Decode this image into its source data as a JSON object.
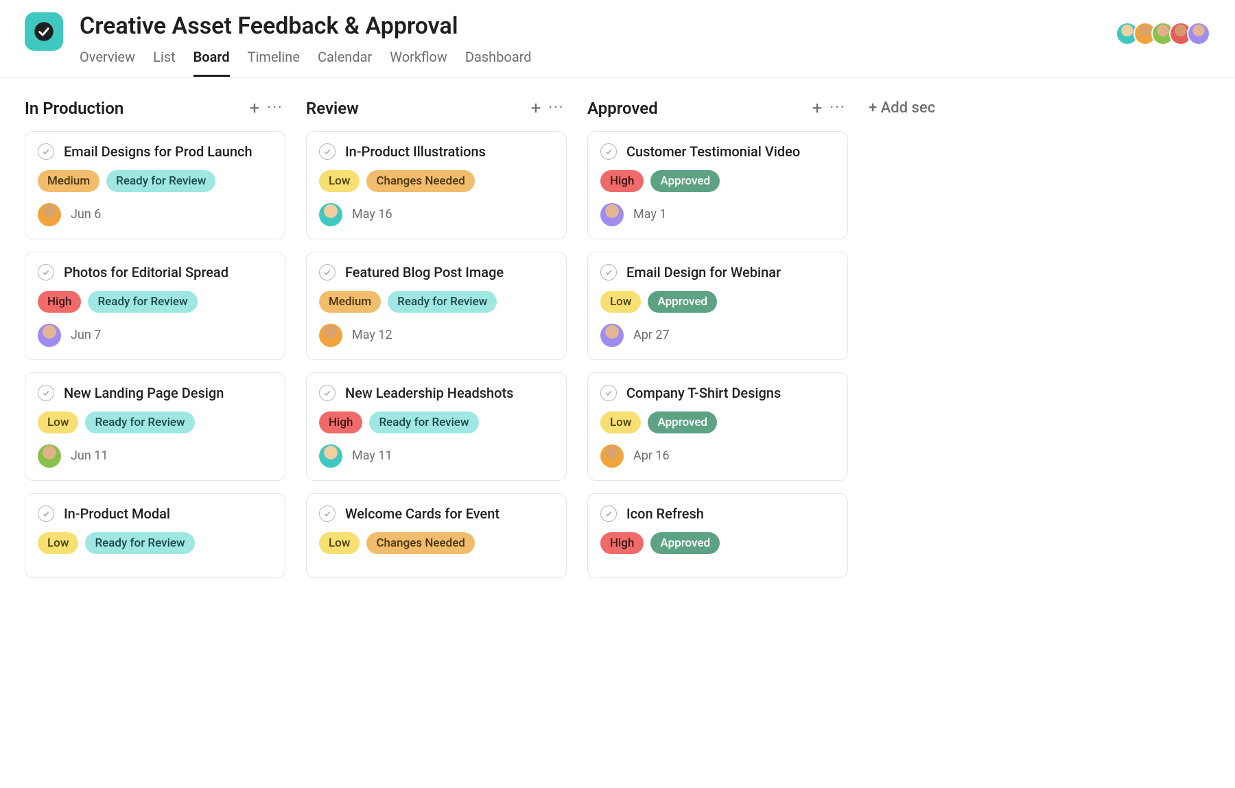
{
  "project": {
    "title": "Creative Asset Feedback & Approval",
    "tabs": [
      "Overview",
      "List",
      "Board",
      "Timeline",
      "Calendar",
      "Workflow",
      "Dashboard"
    ],
    "active_tab": "Board",
    "members": [
      "teal",
      "orange",
      "green",
      "red",
      "purple"
    ]
  },
  "add_section_label": "+ Add sec",
  "tag_colors": {
    "High": {
      "bg": "#f06a6a",
      "fg": "#3a1717"
    },
    "Medium": {
      "bg": "#f1bd6c",
      "fg": "#4a3510"
    },
    "Low": {
      "bg": "#f8df72",
      "fg": "#4a4010"
    },
    "Ready for Review": {
      "bg": "#9ee7e3",
      "fg": "#1d4946"
    },
    "Changes Needed": {
      "bg": "#f1bd6c",
      "fg": "#4a3510"
    },
    "Approved": {
      "bg": "#5da283",
      "fg": "#ffffff"
    }
  },
  "columns": [
    {
      "title": "In Production",
      "cards": [
        {
          "title": "Email Designs for Prod Launch",
          "tags": [
            "Medium",
            "Ready for Review"
          ],
          "assignee": "orange",
          "due": "Jun 6"
        },
        {
          "title": "Photos for Editorial Spread",
          "tags": [
            "High",
            "Ready for Review"
          ],
          "assignee": "purple",
          "due": "Jun 7"
        },
        {
          "title": "New Landing Page Design",
          "tags": [
            "Low",
            "Ready for Review"
          ],
          "assignee": "green",
          "due": "Jun 11"
        },
        {
          "title": "In-Product Modal",
          "tags": [
            "Low",
            "Ready for Review"
          ],
          "assignee": "",
          "due": ""
        }
      ]
    },
    {
      "title": "Review",
      "cards": [
        {
          "title": "In-Product Illustrations",
          "tags": [
            "Low",
            "Changes Needed"
          ],
          "assignee": "teal",
          "due": "May 16"
        },
        {
          "title": "Featured Blog Post Image",
          "tags": [
            "Medium",
            "Ready for Review"
          ],
          "assignee": "orange",
          "due": "May 12"
        },
        {
          "title": "New Leadership Headshots",
          "tags": [
            "High",
            "Ready for Review"
          ],
          "assignee": "teal",
          "due": "May 11"
        },
        {
          "title": "Welcome Cards for Event",
          "tags": [
            "Low",
            "Changes Needed"
          ],
          "assignee": "",
          "due": ""
        }
      ]
    },
    {
      "title": "Approved",
      "cards": [
        {
          "title": "Customer Testimonial Video",
          "tags": [
            "High",
            "Approved"
          ],
          "assignee": "purple",
          "due": "May 1"
        },
        {
          "title": "Email Design for Webinar",
          "tags": [
            "Low",
            "Approved"
          ],
          "assignee": "purple",
          "due": "Apr 27"
        },
        {
          "title": "Company T-Shirt Designs",
          "tags": [
            "Low",
            "Approved"
          ],
          "assignee": "orange",
          "due": "Apr 16"
        },
        {
          "title": "Icon Refresh",
          "tags": [
            "High",
            "Approved"
          ],
          "assignee": "",
          "due": ""
        }
      ]
    }
  ]
}
